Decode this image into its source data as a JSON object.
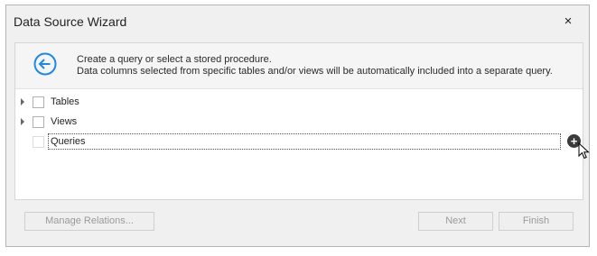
{
  "window": {
    "title": "Data Source Wizard",
    "close_label": "×"
  },
  "header": {
    "line1": "Create a query or select a stored procedure.",
    "line2": "Data columns selected from specific tables and/or views will be automatically included into a separate query."
  },
  "tree": {
    "items": [
      {
        "label": "Tables",
        "expandable": true
      },
      {
        "label": "Views",
        "expandable": true
      },
      {
        "label": "Queries",
        "expandable": false,
        "selected": true
      }
    ],
    "add_icon": "+"
  },
  "footer": {
    "manage_relations": "Manage Relations...",
    "next": "Next",
    "finish": "Finish"
  },
  "colors": {
    "accent": "#1e88e5",
    "window_bg": "#f0f0f0",
    "panel_bg": "#ffffff",
    "disabled_text": "#9a9a9a"
  }
}
